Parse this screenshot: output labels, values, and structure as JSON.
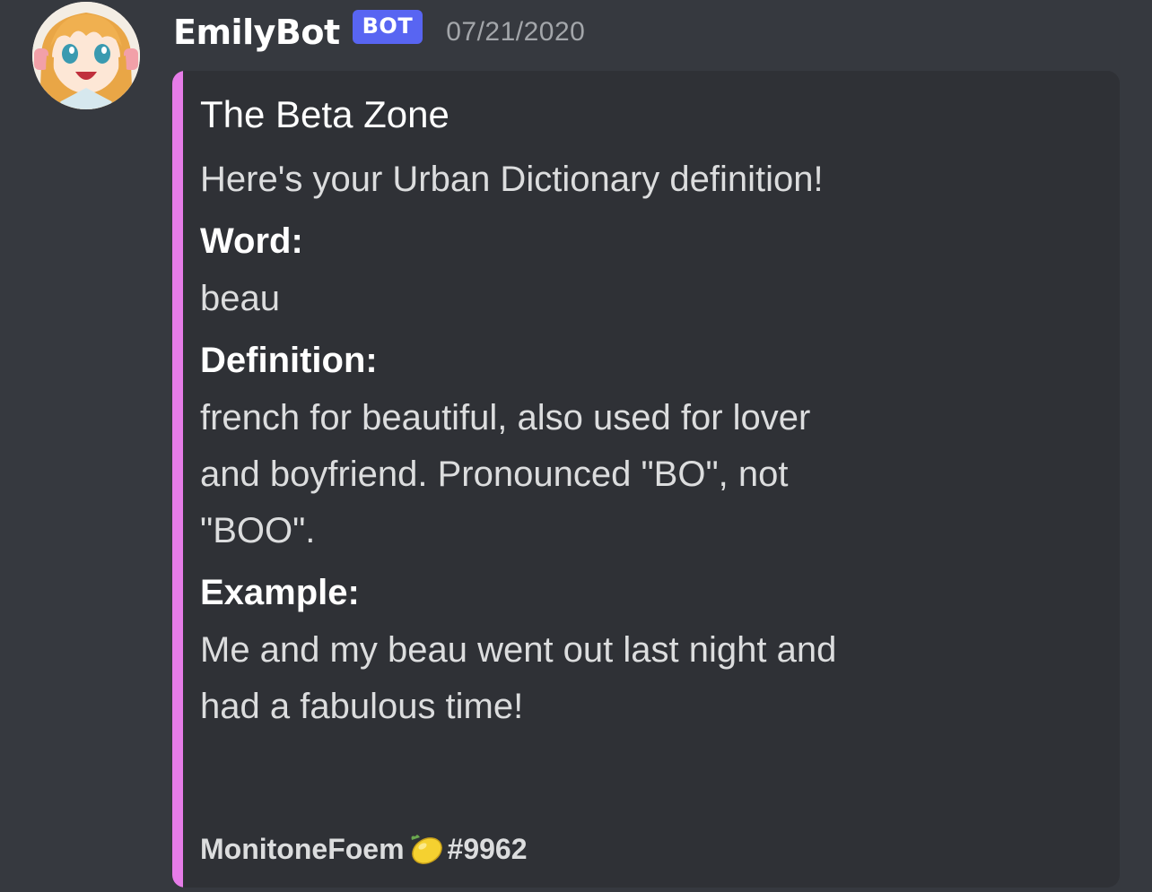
{
  "message": {
    "username": "EmilyBot",
    "bot_tag": "BOT",
    "timestamp": "07/21/2020",
    "avatar_icon": "anime-girl-avatar"
  },
  "embed": {
    "accent_color": "#e67ce8",
    "title": "The Beta Zone",
    "description": "Here's your Urban Dictionary definition!",
    "fields": [
      {
        "name": "Word:",
        "value": "beau"
      },
      {
        "name": "Definition:",
        "value": "french for beautiful, also used for lover and boyfriend. Pronounced \"BO\", not \"BOO\"."
      },
      {
        "name": "Example:",
        "value": "Me and my beau went out last night and had a fabulous time!"
      }
    ],
    "footer": {
      "name": "MonitoneFoem",
      "emoji_icon": "lemon-icon",
      "discriminator": "#9962"
    }
  },
  "colors": {
    "background": "#36393f",
    "embed_background": "#2f3136",
    "bot_tag": "#5865f2"
  }
}
